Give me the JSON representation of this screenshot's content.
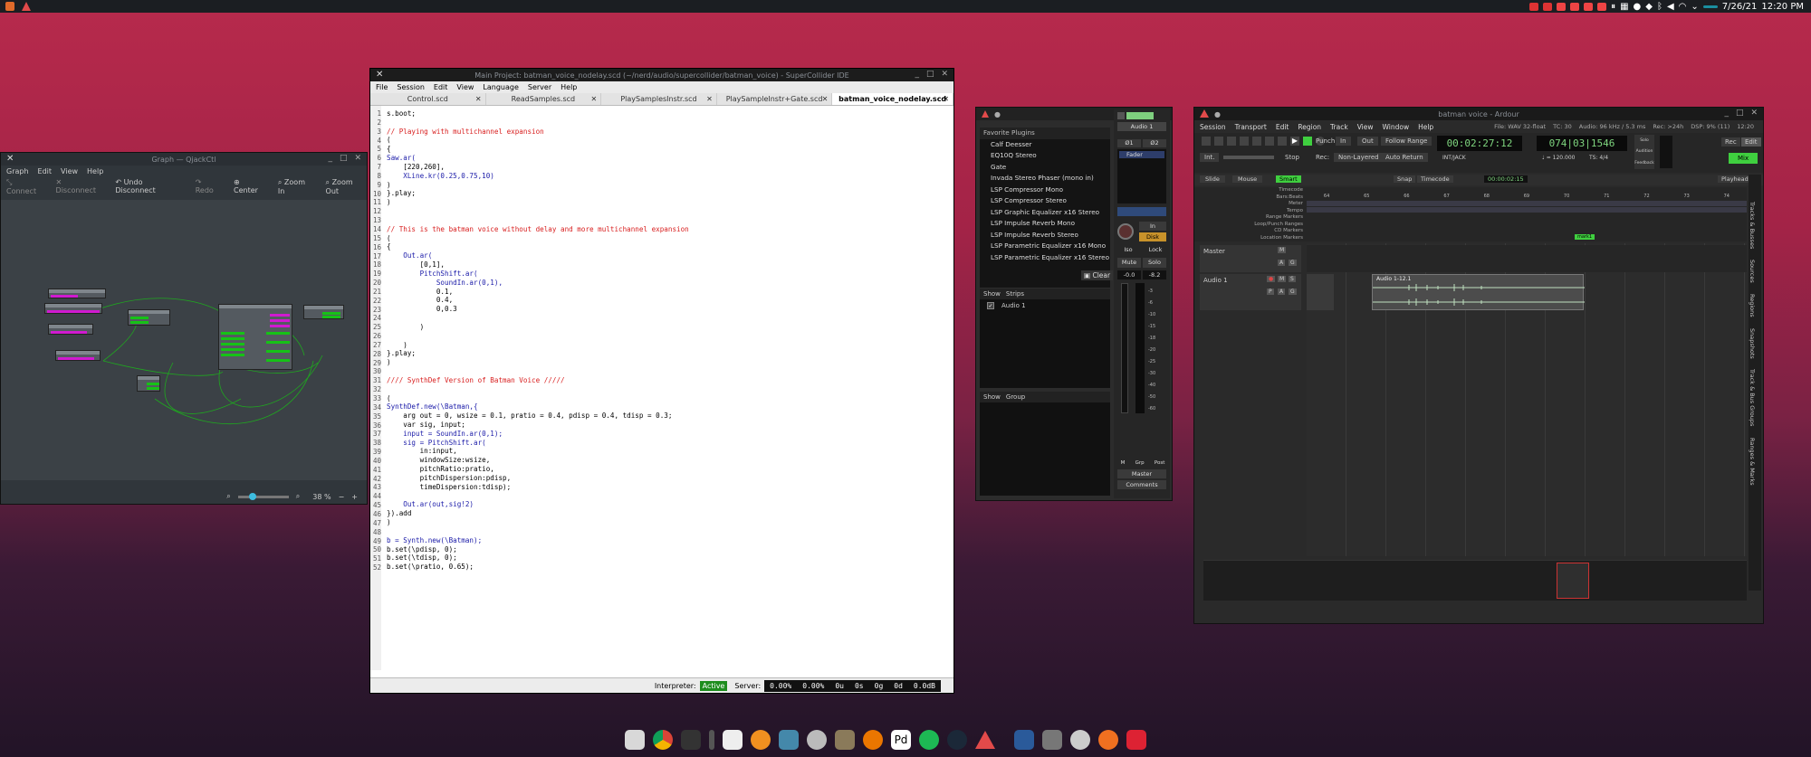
{
  "topbar": {
    "date": "7/26/21",
    "time": "12:20 PM"
  },
  "qjackctl": {
    "title": "Graph — QjackCtl",
    "menu": [
      "Graph",
      "Edit",
      "View",
      "Help"
    ],
    "toolbar": {
      "connect": "Connect",
      "disconnect": "Disconnect",
      "undo": "Undo Disconnect",
      "redo": "Redo",
      "center": "Center",
      "zoom_in": "Zoom In",
      "zoom_out": "Zoom Out"
    },
    "zoom": "38 %"
  },
  "sc": {
    "title": "Main Project: batman_voice_nodelay.scd (~/nerd/audio/supercollider/batman_voice) - SuperCollider IDE",
    "menu": [
      "File",
      "Session",
      "Edit",
      "View",
      "Language",
      "Server",
      "Help"
    ],
    "tabs": [
      "Control.scd",
      "ReadSamples.scd",
      "PlaySamplesInstr.scd",
      "PlaySampleInstr+Gate.scd",
      "batman_voice_nodelay.scd"
    ],
    "code": [
      "s.boot;",
      "",
      "// Playing with multichannel expansion",
      "(",
      "{",
      "Saw.ar(",
      "    [220,260],",
      "    XLine.kr(0.25,0.75,10)",
      ")",
      "}.play;",
      ")",
      "",
      "",
      "// This is the batman voice without delay and more multichannel expansion",
      "(",
      "{",
      "    Out.ar(",
      "        [0,1],",
      "        PitchShift.ar(",
      "            SoundIn.ar(0,1),",
      "            0.1,",
      "            0.4,",
      "            0,0.3",
      "",
      "        )",
      "",
      "    )",
      "}.play;",
      ")",
      "",
      "//// SynthDef Version of Batman Voice /////",
      "",
      "(",
      "SynthDef.new(\\Batman,{",
      "    arg out = 0, wsize = 0.1, pratio = 0.4, pdisp = 0.4, tdisp = 0.3;",
      "    var sig, input;",
      "    input = SoundIn.ar(0,1);",
      "    sig = PitchShift.ar(",
      "        in:input,",
      "        windowSize:wsize,",
      "        pitchRatio:pratio,",
      "        pitchDispersion:pdisp,",
      "        timeDispersion:tdisp);",
      "",
      "    Out.ar(out,sig!2)",
      "}).add",
      ")",
      "",
      "b = Synth.new(\\Batman);",
      "b.set(\\pdisp, 0);",
      "b.set(\\tdisp, 0);",
      "b.set(\\pratio, 0.65);"
    ],
    "status": {
      "interpreter_label": "Interpreter:",
      "interpreter_state": "Active",
      "server_label": "Server:",
      "server_values": [
        "0.00%",
        "0.00%",
        "0u",
        "0s",
        "0g",
        "0d",
        "0.0dB"
      ]
    }
  },
  "mixer": {
    "favorites_header": "Favorite Plugins",
    "plugins": [
      "Calf Deesser",
      "EQ10Q Stereo",
      "Gate",
      "Invada Stereo Phaser (mono in)",
      "LSP Compressor Mono",
      "LSP Compressor Stereo",
      "LSP Graphic Equalizer x16 Stereo",
      "LSP Impulse Reverb Mono",
      "LSP Impulse Reverb Stereo",
      "LSP Parametric Equalizer x16 Mono",
      "LSP Parametric Equalizer x16 Stereo"
    ],
    "clear": "Clear",
    "strips_header": [
      "Show",
      "Strips"
    ],
    "strip_item": "Audio 1",
    "group_header": [
      "Show",
      "Group"
    ],
    "strip": {
      "name": "Audio 1",
      "phase1": "Ø1",
      "phase2": "Ø2",
      "fader": "Fader",
      "in": "In",
      "disk": "Disk",
      "iso": "Iso",
      "lock": "Lock",
      "mute": "Mute",
      "solo": "Solo",
      "gain": "-0.0",
      "peak": "-8.2",
      "meter_ticks": [
        "-3",
        "-6",
        "-10",
        "-15",
        "-18",
        "-20",
        "-25",
        "-30",
        "-40",
        "-50",
        "-60"
      ],
      "m": "M",
      "grp": "Grp",
      "post": "Post",
      "master": "Master",
      "comments": "Comments"
    }
  },
  "ardour": {
    "title": "batman voice - Ardour",
    "menu": [
      "Session",
      "Transport",
      "Edit",
      "Region",
      "Track",
      "View",
      "Window",
      "Help"
    ],
    "info": {
      "file": "File: WAV 32-float",
      "tc": "TC: 30",
      "audio": "Audio: 96 kHz / 5.3 ms",
      "rec": "Rec: >24h",
      "dsp": "DSP: 9% (11)",
      "clock": "12:20"
    },
    "punch": "Punch:",
    "punch_in": "In",
    "punch_out": "Out",
    "int": "Int.",
    "stop": "Stop",
    "rec_label": "Rec:",
    "rec_mode": "Non-Layered",
    "follow_range": "Follow Range",
    "auto_return": "Auto Return",
    "primary_clock": "00:02:27:12",
    "secondary_clock": "074|03|1546",
    "int_jack": "INT/JACK",
    "tempo": "♩ = 120.000",
    "meter": "TS: 4/4",
    "solo": "Solo",
    "audition": "Audition",
    "feedback": "Feedback",
    "rec_btn": "Rec",
    "edit_btn": "Edit",
    "mix_btn": "Mix",
    "edit_mode": "Slide",
    "ripple": "Mouse",
    "smart": "Smart",
    "snap": "Snap",
    "timecode": "Timecode",
    "nudge_clock": "00:00:02:15",
    "playhead": "Playhead",
    "rulers": [
      "Timecode",
      "Bars:Beats",
      "Meter",
      "Tempo",
      "Range Markers",
      "Loop/Punch Ranges",
      "CD Markers",
      "Location Markers"
    ],
    "bars": [
      "64",
      "65",
      "66",
      "67",
      "68",
      "69",
      "70",
      "71",
      "72",
      "73",
      "74"
    ],
    "marker": "mark1",
    "tracks": [
      {
        "name": "Master",
        "buttons": [
          "M",
          "A",
          "G"
        ]
      },
      {
        "name": "Audio 1",
        "buttons": [
          "●",
          "M",
          "S",
          "P",
          "A",
          "G"
        ],
        "region": "Audio 1-12.1"
      }
    ],
    "sidebar": [
      "Tracks & Busses",
      "Sources",
      "Regions",
      "Snapshots",
      "Track & Bus Groups",
      "Ranges & Marks"
    ]
  },
  "colors": {
    "accent_green": "#33cc33",
    "brand_red": "#e24a4a",
    "sc_active": "#1e8d1e"
  }
}
